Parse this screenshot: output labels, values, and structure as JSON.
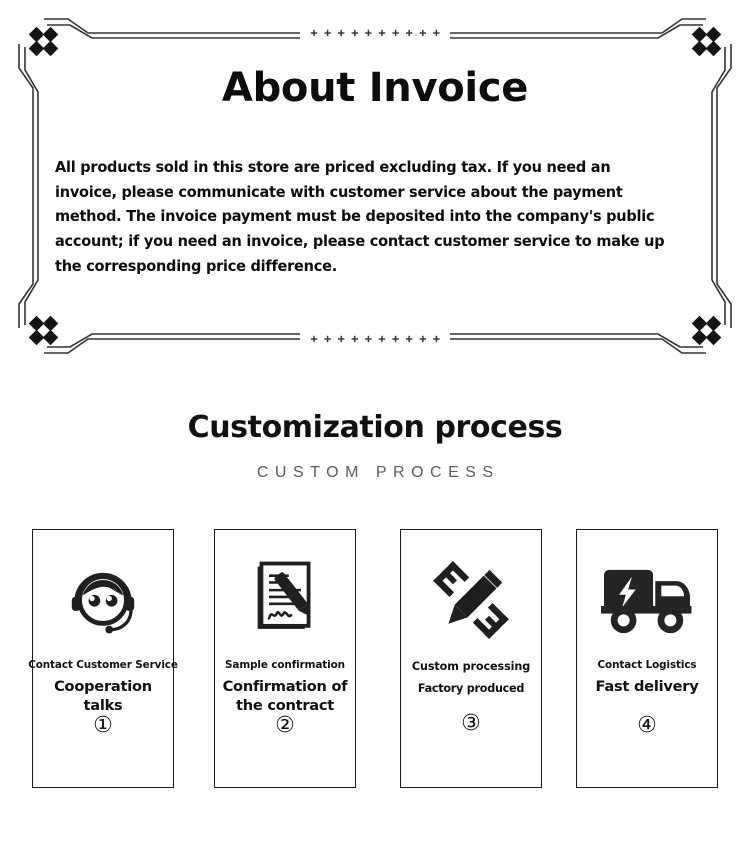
{
  "invoice": {
    "title": "About Invoice",
    "body": "All products sold in this store are priced excluding tax. If you need an invoice, please communicate with customer service about the payment method. The invoice payment must be deposited into the company's public account; if you need an invoice, please contact customer service to make up the corresponding price difference.",
    "frame": {
      "ornament_glyph": "+",
      "ornament_count_top": 10,
      "ornament_count_bottom": 10,
      "corner_motif": "four-diamond-cluster",
      "line_color": "#333333",
      "diamond_color": "#111111"
    }
  },
  "process": {
    "heading": "Customization process",
    "subheading": "CUSTOM PROCESS",
    "cards": [
      {
        "icon": "headset-customer-service-icon",
        "sub": "Contact Customer Service",
        "title": "Cooperation talks",
        "number": "①"
      },
      {
        "icon": "contract-signing-icon",
        "sub": "Sample confirmation",
        "title": "Confirmation of the contract",
        "number": "②"
      },
      {
        "icon": "pencil-ruler-icon",
        "sub": "Custom processing",
        "title": "Factory produced",
        "number": "③"
      },
      {
        "icon": "delivery-truck-icon",
        "sub": "Contact Logistics",
        "title": "Fast delivery",
        "number": "④"
      }
    ]
  },
  "colors": {
    "text": "#111111",
    "subheading": "#5c5c5c",
    "background": "#ffffff",
    "border": "#1a1a1a"
  }
}
